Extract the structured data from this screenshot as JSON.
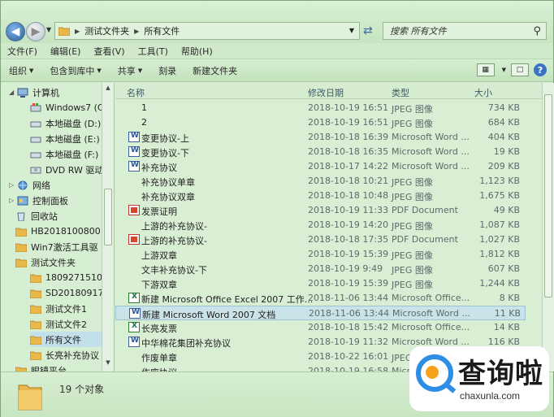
{
  "address": {
    "crumbs": [
      "测试文件夹",
      "所有文件"
    ],
    "search_placeholder": "搜索 所有文件"
  },
  "menu": [
    "文件(F)",
    "编辑(E)",
    "查看(V)",
    "工具(T)",
    "帮助(H)"
  ],
  "toolbar": {
    "organize": "组织",
    "include_library": "包含到库中",
    "share": "共享",
    "burn": "刻录",
    "new_folder": "新建文件夹"
  },
  "nav": {
    "items": [
      {
        "label": "计算机",
        "icon": "computer-icon"
      },
      {
        "label": "Windows7 (C:",
        "icon": "drive-c-icon"
      },
      {
        "label": "本地磁盘 (D:)",
        "icon": "drive-icon"
      },
      {
        "label": "本地磁盘 (E:)",
        "icon": "drive-icon"
      },
      {
        "label": "本地磁盘 (F:)",
        "icon": "drive-icon"
      },
      {
        "label": "DVD RW 驱动",
        "icon": "dvd-icon"
      },
      {
        "label": "网络",
        "icon": "network-icon"
      },
      {
        "label": "控制面板",
        "icon": "control-panel-icon"
      },
      {
        "label": "回收站",
        "icon": "recycle-bin-icon"
      },
      {
        "label": "HB2018100800",
        "icon": "folder-icon"
      },
      {
        "label": "Win7激活工具驱",
        "icon": "folder-icon"
      },
      {
        "label": "测试文件夹",
        "icon": "folder-icon"
      },
      {
        "label": "180927151005",
        "icon": "folder-icon"
      },
      {
        "label": "SD201809170",
        "icon": "folder-icon"
      },
      {
        "label": "测试文件1",
        "icon": "folder-icon"
      },
      {
        "label": "测试文件2",
        "icon": "folder-icon"
      },
      {
        "label": "所有文件",
        "icon": "folder-icon"
      },
      {
        "label": "长亮补充协议 (",
        "icon": "folder-icon"
      },
      {
        "label": "眼镜平台",
        "icon": "folder-icon"
      }
    ]
  },
  "columns": {
    "name": "名称",
    "date": "修改日期",
    "type": "类型",
    "size": "大小"
  },
  "files": [
    {
      "name": "1",
      "date": "2018-10-19 16:51",
      "type": "JPEG 图像",
      "size": "734 KB",
      "icon": "image"
    },
    {
      "name": "2",
      "date": "2018-10-19 16:51",
      "type": "JPEG 图像",
      "size": "684 KB",
      "icon": "image"
    },
    {
      "name": "变更协议-上",
      "date": "2018-10-18 16:39",
      "type": "Microsoft Word ...",
      "size": "404 KB",
      "icon": "word"
    },
    {
      "name": "变更协议-下",
      "date": "2018-10-18 16:35",
      "type": "Microsoft Word ...",
      "size": "19 KB",
      "icon": "word"
    },
    {
      "name": "补充协议",
      "date": "2018-10-17 14:22",
      "type": "Microsoft Word ...",
      "size": "209 KB",
      "icon": "word"
    },
    {
      "name": "补充协议单章",
      "date": "2018-10-18 10:21",
      "type": "JPEG 图像",
      "size": "1,123 KB",
      "icon": "image"
    },
    {
      "name": "补充协议双章",
      "date": "2018-10-18 10:48",
      "type": "JPEG 图像",
      "size": "1,675 KB",
      "icon": "image"
    },
    {
      "name": "发票证明",
      "date": "2018-10-19 11:33",
      "type": "PDF Document",
      "size": "49 KB",
      "icon": "pdf"
    },
    {
      "name": "上游的补充协议-",
      "date": "2018-10-19 14:20",
      "type": "JPEG 图像",
      "size": "1,087 KB",
      "icon": "image"
    },
    {
      "name": "上游的补充协议-",
      "date": "2018-10-18 17:35",
      "type": "PDF Document",
      "size": "1,027 KB",
      "icon": "pdf"
    },
    {
      "name": "上游双章",
      "date": "2018-10-19 15:39",
      "type": "JPEG 图像",
      "size": "1,812 KB",
      "icon": "image"
    },
    {
      "name": "文丰补充协议-下",
      "date": "2018-10-19 9:49",
      "type": "JPEG 图像",
      "size": "607 KB",
      "icon": "image"
    },
    {
      "name": "下游双章",
      "date": "2018-10-19 15:39",
      "type": "JPEG 图像",
      "size": "1,244 KB",
      "icon": "image"
    },
    {
      "name": "新建 Microsoft Office Excel 2007 工作...",
      "date": "2018-11-06 13:44",
      "type": "Microsoft Office...",
      "size": "8 KB",
      "icon": "excel"
    },
    {
      "name": "新建 Microsoft Word 2007 文档",
      "date": "2018-11-06 13:44",
      "type": "Microsoft Word ...",
      "size": "11 KB",
      "icon": "word",
      "selected": true
    },
    {
      "name": "长亮发票",
      "date": "2018-10-18 15:42",
      "type": "Microsoft Office...",
      "size": "14 KB",
      "icon": "excel"
    },
    {
      "name": "中华棉花集团补充协议",
      "date": "2018-10-19 11:32",
      "type": "Microsoft Word ...",
      "size": "116 KB",
      "icon": "word"
    },
    {
      "name": "作废单章",
      "date": "2018-10-22 16:01",
      "type": "JPEG 图像",
      "size": "",
      "icon": "image"
    },
    {
      "name": "作废协议",
      "date": "2018-10-19 16:58",
      "type": "Micr",
      "size": "",
      "icon": "image"
    }
  ],
  "status": {
    "count_text": "19 个对象"
  },
  "logo": {
    "text_cn": "查询啦",
    "url": "chaxunla.com"
  }
}
